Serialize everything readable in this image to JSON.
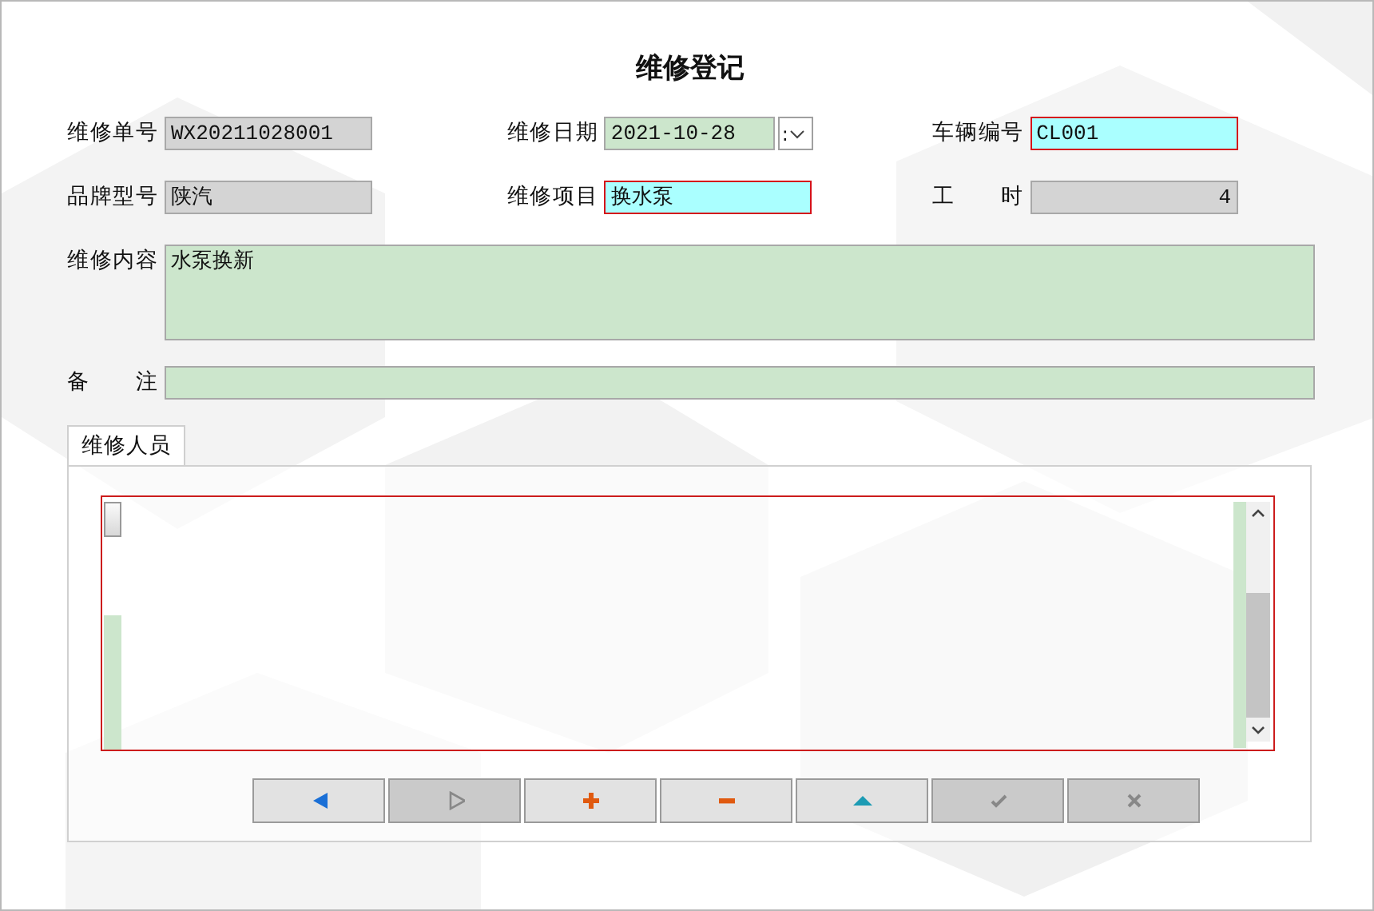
{
  "window": {
    "title": "维修登记"
  },
  "rows": [
    [
      {
        "label": "维修单号",
        "value": "WX20211028001",
        "readonly": true,
        "required": false,
        "kind": "text"
      },
      {
        "label": "维修日期",
        "value": "2021-10-28",
        "readonly": false,
        "required": false,
        "kind": "date",
        "spin_text": ":"
      },
      {
        "label": "车辆编号",
        "value": "CL001",
        "readonly": false,
        "required": true,
        "kind": "text"
      }
    ],
    [
      {
        "label": "品牌型号",
        "value": "陕汽",
        "readonly": true,
        "required": false,
        "kind": "text"
      },
      {
        "label": "维修项目",
        "value": "换水泵",
        "readonly": false,
        "required": true,
        "kind": "text"
      },
      {
        "label": "工 时",
        "value": "4",
        "readonly": true,
        "required": false,
        "kind": "number"
      }
    ],
    [
      {
        "label": "维修内容",
        "value": "水泵换新",
        "readonly": false,
        "required": false,
        "kind": "multiline"
      }
    ],
    [
      {
        "label": "备 注",
        "readonly": false,
        "required": false,
        "kind": "line"
      }
    ]
  ],
  "tabs": [
    {
      "label": "维修人员",
      "selected": true
    }
  ],
  "nav_buttons": [
    {
      "kind": "prev",
      "disabled": false
    },
    {
      "kind": "next",
      "disabled": true
    },
    {
      "kind": "add",
      "disabled": false
    },
    {
      "kind": "remove",
      "disabled": false
    },
    {
      "kind": "up",
      "disabled": false
    },
    {
      "kind": "save",
      "disabled": true
    },
    {
      "kind": "cancel",
      "disabled": true
    }
  ]
}
